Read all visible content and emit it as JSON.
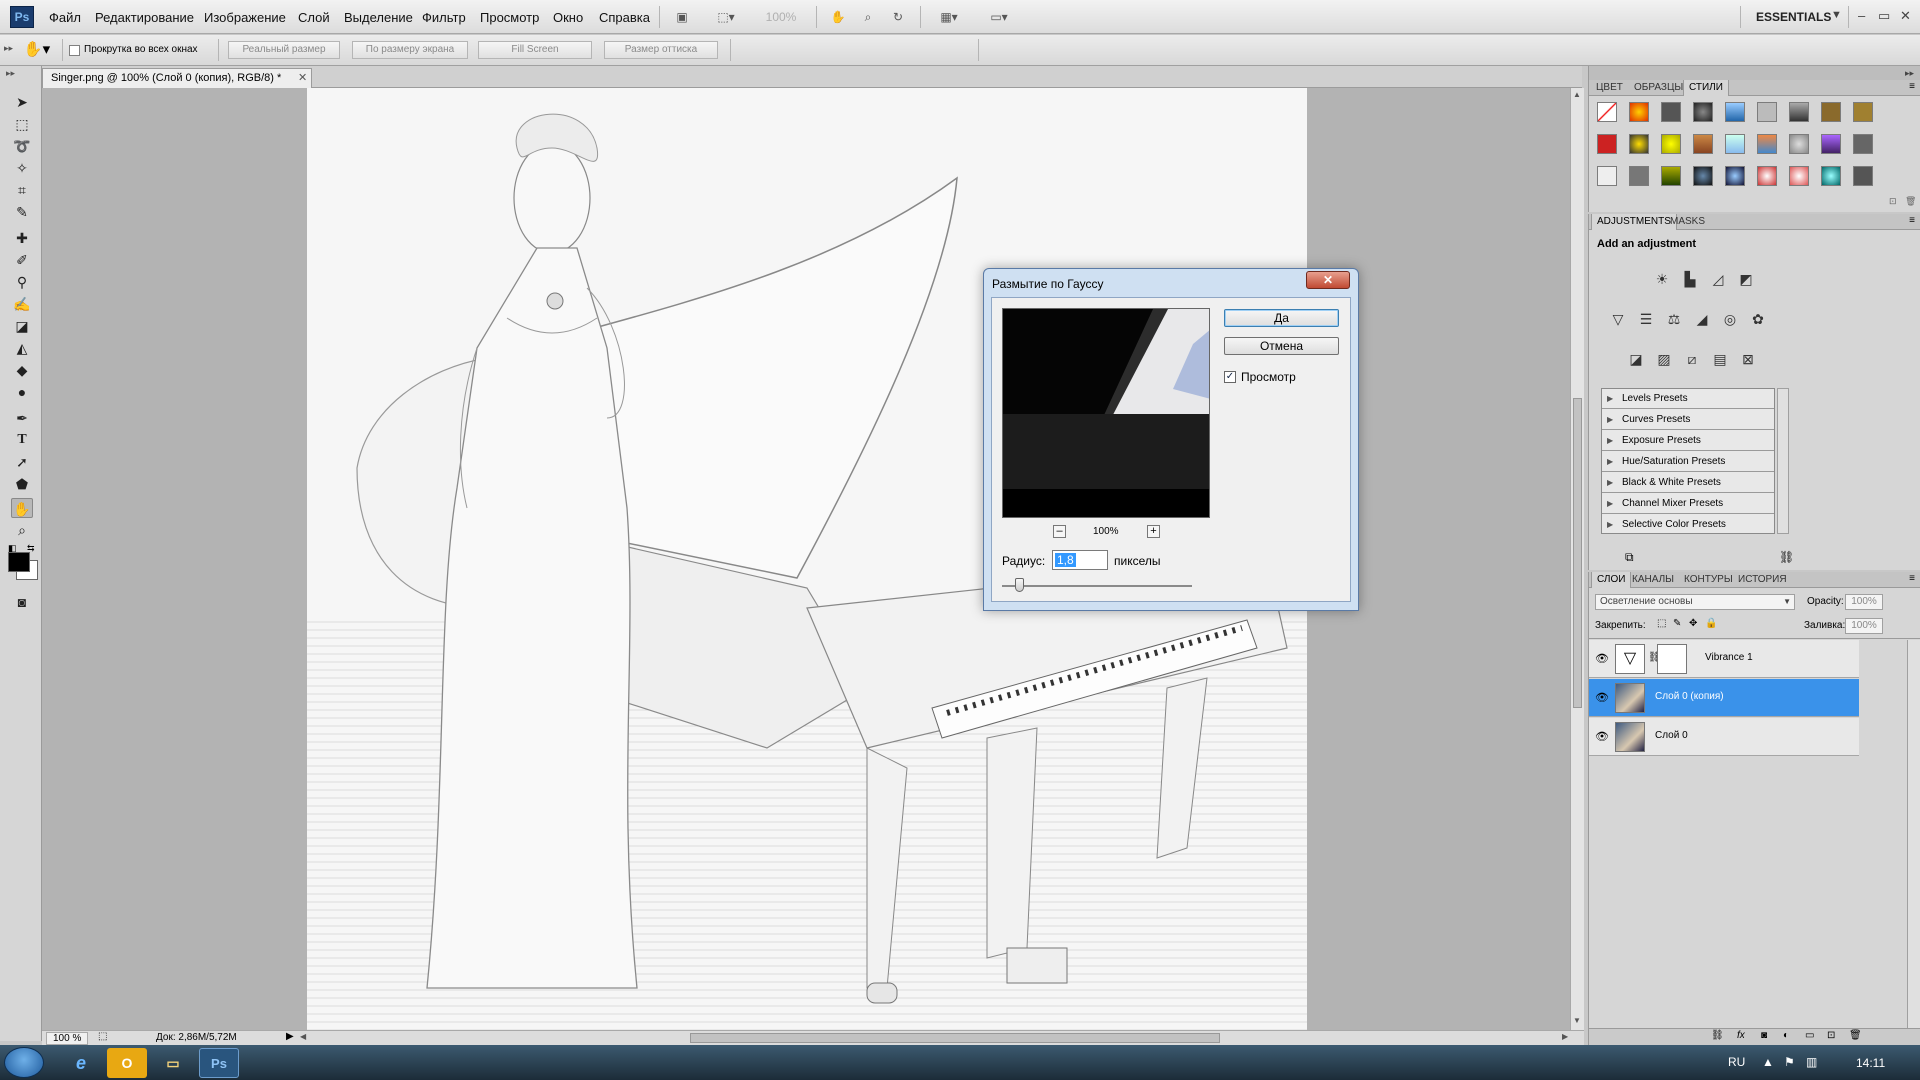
{
  "app": {
    "logo": "Ps",
    "menu": [
      "Файл",
      "Редактирование",
      "Изображение",
      "Слой",
      "Выделение",
      "Фильтр",
      "Просмотр",
      "Окно",
      "Справка"
    ],
    "zoom_field": "100%",
    "workspace": "ESSENTIALS",
    "window_controls": [
      "–",
      "▭",
      "✕"
    ]
  },
  "options_bar": {
    "scroll_all_label": "Прокрутка во всех окнах",
    "buttons": [
      "Реальный размер",
      "По размеру экрана",
      "Fill Screen",
      "Размер оттиска"
    ]
  },
  "document": {
    "tab_title": "Singer.png @ 100% (Слой 0 (копия), RGB/8) *",
    "tab_close": "✕",
    "status_zoom": "100 %",
    "status_doc": "Док: 2,86M/5,72M"
  },
  "styles_panel": {
    "tabs": [
      "ЦВЕТ",
      "ОБРАЗЦЫ",
      "СТИЛИ"
    ],
    "active_tab": "СТИЛИ"
  },
  "adjustments_panel": {
    "tabs": [
      "ADJUSTMENTS",
      "MASKS"
    ],
    "heading": "Add an adjustment",
    "presets": [
      "Levels Presets",
      "Curves Presets",
      "Exposure Presets",
      "Hue/Saturation Presets",
      "Black & White Presets",
      "Channel Mixer Presets",
      "Selective Color Presets"
    ]
  },
  "layers_panel": {
    "tabs": [
      "СЛОИ",
      "КАНАЛЫ",
      "КОНТУРЫ",
      "ИСТОРИЯ"
    ],
    "blend_mode": "Осветление основы",
    "opacity_label": "Opacity:",
    "opacity_value": "100%",
    "lock_label": "Закрепить:",
    "fill_label": "Заливка:",
    "fill_value": "100%",
    "layers": [
      {
        "name": "Vibrance 1",
        "selected": false
      },
      {
        "name": "Слой 0 (копия)",
        "selected": true
      },
      {
        "name": "Слой 0",
        "selected": false
      }
    ]
  },
  "dialog": {
    "title": "Размытие по Гауссу",
    "ok": "Да",
    "cancel": "Отмена",
    "preview_label": "Просмотр",
    "preview_checked": true,
    "zoom_out": "–",
    "zoom_in": "+",
    "preview_zoom": "100%",
    "radius_label": "Радиус:",
    "radius_value": "1,8",
    "radius_unit": "пикселы",
    "radius_slider": 0.09
  },
  "taskbar": {
    "lang": "RU",
    "time": "14:11",
    "apps": [
      "e",
      "O",
      "▭",
      "Ps"
    ]
  },
  "colors": {
    "selection_blue": "#3a92ea",
    "dialog_frame": "#cfe0f2",
    "taskbar": "#2b4456"
  }
}
